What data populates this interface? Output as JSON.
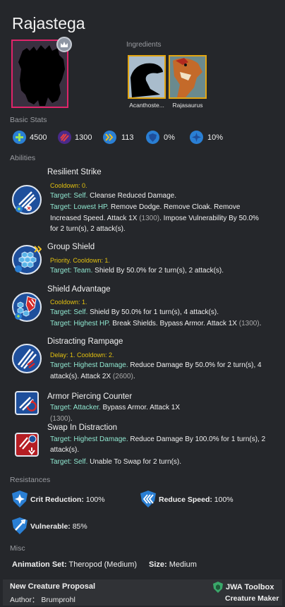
{
  "creature": {
    "name": "Rajastega",
    "portrait_alt": "silhouette",
    "rank_icon": "crown-icon",
    "border_color": "#e0246a"
  },
  "ingredients": {
    "label": "Ingredients",
    "items": [
      {
        "name": "Acanthoste..."
      },
      {
        "name": "Rajasaurus"
      }
    ],
    "border_color": "#e2a512"
  },
  "basic_stats": {
    "label": "Basic Stats",
    "items": [
      {
        "icon": "health-icon",
        "value": "4500",
        "color": "#2a7fd4"
      },
      {
        "icon": "damage-icon",
        "value": "1300",
        "color": "#4a2a8a"
      },
      {
        "icon": "speed-icon",
        "value": "113",
        "color": "#2a7fd4"
      },
      {
        "icon": "armor-icon",
        "value": "0%",
        "color": "#2a7fd4"
      },
      {
        "icon": "crit-icon",
        "value": "10%",
        "color": "#2a7fd4"
      }
    ]
  },
  "abilities": {
    "label": "Abilities",
    "items": [
      {
        "name": "Resilient Strike",
        "meta": "Cooldown: 0.",
        "lines": [
          {
            "target": "Target: Self.",
            "text": " Cleanse Reduced Damage."
          },
          {
            "target": "Target: Lowest HP.",
            "text": " Remove Dodge. Remove Cloak. Remove"
          },
          {
            "target": "",
            "text": "Increased Speed. Attack 1X ",
            "grey": "(1300)",
            "after": ". Impose Vulnerability By 50.0%"
          },
          {
            "target": "",
            "text": "for 2 turn(s), 2 attack(s)."
          }
        ]
      },
      {
        "name": "Group Shield",
        "meta": "Priority. Cooldown: 1.",
        "lines": [
          {
            "target": "Target: Team.",
            "text": " Shield By 50.0% for 2 turn(s), 2 attack(s)."
          }
        ]
      },
      {
        "name": "Shield Advantage",
        "meta": "Cooldown: 1.",
        "lines": [
          {
            "target": "Target: Self.",
            "text": " Shield By 50.0% for 1 turn(s), 4 attack(s)."
          },
          {
            "target": "Target: Highest HP.",
            "text": " Break Shields. Bypass Armor. Attack 1X ",
            "grey": "(1300)",
            "after": "."
          }
        ]
      },
      {
        "name": "Distracting Rampage",
        "meta": "Delay: 1. Cooldown: 2.",
        "lines": [
          {
            "target": "Target: Highest Damage.",
            "text": " Reduce Damage By 50.0% for 2 turn(s), 4"
          },
          {
            "target": "",
            "text": "attack(s). Attack 2X ",
            "grey": "(2600)",
            "after": "."
          }
        ]
      },
      {
        "name": "Armor Piercing Counter",
        "meta": "",
        "lines": [
          {
            "target": "Target: Attacker.",
            "text": " Bypass Armor. Attack 1X"
          },
          {
            "target": "",
            "text": "",
            "grey": "(1300)",
            "after": "."
          }
        ]
      },
      {
        "name": "Swap In Distraction",
        "meta": "",
        "lines": [
          {
            "target": "Target: Highest Damage.",
            "text": " Reduce Damage By 100.0% for 1 turn(s), 2"
          },
          {
            "target": "",
            "text": "attack(s)."
          },
          {
            "target": "Target: Self.",
            "text": " Unable To Swap for 2 turn(s)."
          }
        ]
      }
    ]
  },
  "resistances": {
    "label": "Resistances",
    "items": [
      {
        "icon": "crit-reduction-icon",
        "name": "Crit Reduction:",
        "value": " 100%"
      },
      {
        "icon": "reduce-speed-icon",
        "name": "Reduce Speed:",
        "value": " 100%"
      },
      {
        "icon": "vulnerable-icon",
        "name": "Vulnerable:",
        "value": " 85%"
      }
    ]
  },
  "misc": {
    "label": "Misc",
    "animation_label": "Animation Set:",
    "animation_value": " Theropod (Medium)",
    "size_label": "Size:",
    "size_value": " Medium"
  },
  "footer": {
    "title": "New Creature Proposal",
    "author": "Author： Brumprohl",
    "brand": "JWA Toolbox",
    "subtitle": "Creature Maker"
  },
  "colors": {
    "background": "#25272b",
    "meta_yellow": "#e3c10f",
    "target_teal": "#8fe6cf",
    "ability_blue": "#1e4f9c"
  }
}
